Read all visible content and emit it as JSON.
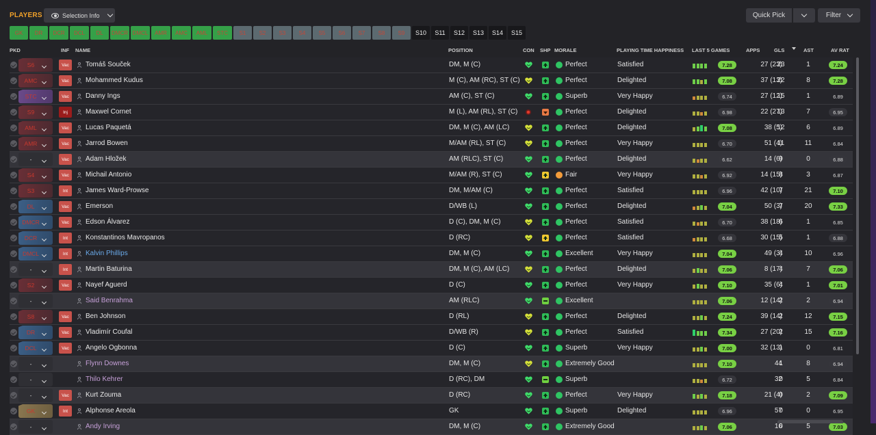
{
  "header": {
    "title": "PLAYERS",
    "view_button": "Selection Info",
    "quick_pick": "Quick Pick",
    "filter": "Filter"
  },
  "position_tabs": [
    {
      "label": "GK",
      "state": "green"
    },
    {
      "label": "DR",
      "state": "green"
    },
    {
      "label": "DCR",
      "state": "green"
    },
    {
      "label": "DCL",
      "state": "green"
    },
    {
      "label": "DL",
      "state": "green"
    },
    {
      "label": "DMCR",
      "state": "green"
    },
    {
      "label": "DMCL",
      "state": "green"
    },
    {
      "label": "AMR",
      "state": "green"
    },
    {
      "label": "AMC",
      "state": "green"
    },
    {
      "label": "AML",
      "state": "green"
    },
    {
      "label": "STC",
      "state": "green"
    },
    {
      "label": "S1",
      "state": "grey"
    },
    {
      "label": "S2",
      "state": "grey"
    },
    {
      "label": "S3",
      "state": "grey"
    },
    {
      "label": "S4",
      "state": "grey"
    },
    {
      "label": "S5",
      "state": "grey"
    },
    {
      "label": "S6",
      "state": "grey"
    },
    {
      "label": "S7",
      "state": "grey"
    },
    {
      "label": "S8",
      "state": "grey"
    },
    {
      "label": "S9",
      "state": "grey"
    },
    {
      "label": "S10",
      "state": "dark"
    },
    {
      "label": "S11",
      "state": "dark"
    },
    {
      "label": "S12",
      "state": "dark"
    },
    {
      "label": "S13",
      "state": "dark"
    },
    {
      "label": "S14",
      "state": "dark"
    },
    {
      "label": "S15",
      "state": "dark"
    }
  ],
  "columns": {
    "pkd": "PKD",
    "inf": "INF",
    "name": "NAME",
    "position": "POSITION",
    "con": "CON",
    "shp": "SHP",
    "morale": "MORALE",
    "pth": "PLAYING TIME HAPPINESS",
    "last5": "LAST 5 GAMES",
    "apps": "APPS",
    "gls": "GLS",
    "ast": "AST",
    "avrat": "AV RAT"
  },
  "colors": {
    "accent": "#f0a12a",
    "rating_good": "#78d044",
    "morale_good": "#2fc463",
    "morale_fair": "#f29b3a"
  },
  "players": [
    {
      "pkd": "S6",
      "pkd_color": "red",
      "inf": "Vac",
      "name": "Tomáš Souček",
      "name_color": "",
      "pos": "DM, M (C)",
      "con": "green",
      "shp": "green",
      "mor_ic": "green",
      "morale": "Perfect",
      "pth": "Satisfied",
      "form": "gggg",
      "l5": "7.28",
      "l5c": "g",
      "apps": "27 (23)",
      "gls": "23",
      "ast": "1",
      "avr": "7.24",
      "avrc": "g",
      "hl": false
    },
    {
      "pkd": "AMC",
      "pkd_color": "red",
      "inf": "Vac",
      "name": "Mohammed Kudus",
      "name_color": "",
      "pos": "M (C), AM (RC), ST (C)",
      "con": "yellow",
      "shp": "green",
      "mor_ic": "green",
      "morale": "Perfect",
      "pth": "Delighted",
      "form": "ggyg",
      "l5": "7.08",
      "l5c": "g",
      "apps": "37 (13)",
      "gls": "22",
      "ast": "8",
      "avr": "7.28",
      "avrc": "g",
      "hl": false
    },
    {
      "pkd": "STC",
      "pkd_color": "purple",
      "inf": "Vac",
      "name": "Danny Ings",
      "name_color": "",
      "pos": "AM (C), ST (C)",
      "con": "green",
      "shp": "green",
      "mor_ic": "green",
      "morale": "Superb",
      "pth": "Very Happy",
      "form": "oyyy",
      "l5": "6.74",
      "l5c": "d",
      "apps": "27 (12)",
      "gls": "15",
      "ast": "1",
      "avr": "6.89",
      "avrc": "plain",
      "hl": false
    },
    {
      "pkd": "S9",
      "pkd_color": "red",
      "inf": "Inj",
      "name": "Maxwel Cornet",
      "name_color": "",
      "pos": "M (L), AM (RL), ST (C)",
      "con": "red",
      "shp": "orange",
      "mor_ic": "green",
      "morale": "Perfect",
      "pth": "Delighted",
      "form": "yyoy",
      "l5": "6.98",
      "l5c": "d",
      "apps": "22 (27)",
      "gls": "13",
      "ast": "7",
      "avr": "6.95",
      "avrc": "d",
      "hl": false
    },
    {
      "pkd": "AML",
      "pkd_color": "red",
      "inf": "Vac",
      "name": "Lucas Paquetá",
      "name_color": "",
      "pos": "DM, M (C), AM (LC)",
      "con": "yellow",
      "shp": "green",
      "mor_ic": "green",
      "morale": "Perfect",
      "pth": "Delighted",
      "form": "ygGg",
      "l5": "7.08",
      "l5c": "g",
      "apps": "38 (5)",
      "gls": "12",
      "ast": "6",
      "avr": "6.89",
      "avrc": "plain",
      "hl": false
    },
    {
      "pkd": "AMR",
      "pkd_color": "red",
      "inf": "Vac",
      "name": "Jarrod Bowen",
      "name_color": "",
      "pos": "M/AM (RL), ST (C)",
      "con": "yellow",
      "shp": "green",
      "mor_ic": "green",
      "morale": "Perfect",
      "pth": "Very Happy",
      "form": "yyyy",
      "l5": "6.70",
      "l5c": "d",
      "apps": "51 (4)",
      "gls": "11",
      "ast": "11",
      "avr": "6.84",
      "avrc": "plain",
      "hl": false
    },
    {
      "pkd": "-",
      "pkd_color": "empty",
      "inf": "Vac",
      "name": "Adam Hložek",
      "name_color": "",
      "pos": "AM (RLC), ST (C)",
      "con": "green",
      "shp": "green",
      "mor_ic": "green",
      "morale": "Perfect",
      "pth": "Delighted",
      "form": "yoyy",
      "l5": "6.62",
      "l5c": "d",
      "apps": "14 (6)",
      "gls": "9",
      "ast": "0",
      "avr": "6.88",
      "avrc": "d",
      "hl": true
    },
    {
      "pkd": "S4",
      "pkd_color": "red",
      "inf": "Vac",
      "name": "Michail Antonio",
      "name_color": "",
      "pos": "M/AM (R), ST (C)",
      "con": "green",
      "shp": "yellow",
      "mor_ic": "orange",
      "morale": "Fair",
      "pth": "Very Happy",
      "form": "yyoy",
      "l5": "6.92",
      "l5c": "d",
      "apps": "14 (15)",
      "gls": "8",
      "ast": "3",
      "avr": "6.87",
      "avrc": "plain",
      "hl": false
    },
    {
      "pkd": "S3",
      "pkd_color": "red",
      "inf": "Int",
      "name": "James Ward-Prowse",
      "name_color": "",
      "pos": "DM, M/AM (C)",
      "con": "green",
      "shp": "green",
      "mor_ic": "green",
      "morale": "Perfect",
      "pth": "Satisfied",
      "form": "yyyy",
      "l5": "6.96",
      "l5c": "d",
      "apps": "42 (10)",
      "gls": "7",
      "ast": "21",
      "avr": "7.10",
      "avrc": "g",
      "hl": false
    },
    {
      "pkd": "DL",
      "pkd_color": "blue",
      "inf": "Vac",
      "name": "Emerson",
      "name_color": "",
      "pos": "D/WB (L)",
      "con": "green",
      "shp": "green",
      "mor_ic": "green",
      "morale": "Perfect",
      "pth": "Delighted",
      "form": "oygy",
      "l5": "7.04",
      "l5c": "g",
      "apps": "50 (3)",
      "gls": "7",
      "ast": "20",
      "avr": "7.33",
      "avrc": "g",
      "hl": false
    },
    {
      "pkd": "DMCR",
      "pkd_color": "blue",
      "inf": "Vac",
      "name": "Edson Álvarez",
      "name_color": "",
      "pos": "D (C), DM, M (C)",
      "con": "yellow",
      "shp": "green",
      "mor_ic": "green",
      "morale": "Perfect",
      "pth": "Satisfied",
      "form": "yoyy",
      "l5": "6.70",
      "l5c": "d",
      "apps": "38 (18)",
      "gls": "6",
      "ast": "1",
      "avr": "6.85",
      "avrc": "plain",
      "hl": false
    },
    {
      "pkd": "DCR",
      "pkd_color": "blue",
      "inf": "Int",
      "name": "Konstantinos Mavropanos",
      "name_color": "",
      "pos": "D (RC)",
      "con": "yellow",
      "shp": "yellow",
      "mor_ic": "green",
      "morale": "Perfect",
      "pth": "Satisfied",
      "form": "oyyy",
      "l5": "6.68",
      "l5c": "d",
      "apps": "30 (15)",
      "gls": "5",
      "ast": "1",
      "avr": "6.88",
      "avrc": "d",
      "hl": false
    },
    {
      "pkd": "DMCL",
      "pkd_color": "blue",
      "inf": "Int",
      "name": "Kalvin Phillips",
      "name_color": "blue",
      "pos": "DM, M (C)",
      "con": "green",
      "shp": "green",
      "mor_ic": "green",
      "morale": "Excellent",
      "pth": "Very Happy",
      "form": "yyyy",
      "l5": "7.04",
      "l5c": "g",
      "apps": "49 (3)",
      "gls": "4",
      "ast": "10",
      "avr": "6.96",
      "avrc": "plain",
      "hl": false
    },
    {
      "pkd": "-",
      "pkd_color": "empty",
      "inf": "Int",
      "name": "Martin Baturina",
      "name_color": "",
      "pos": "DM, M (C), AM (LC)",
      "con": "yellow",
      "shp": "green",
      "mor_ic": "green",
      "morale": "Perfect",
      "pth": "Delighted",
      "form": "ygyy",
      "l5": "7.06",
      "l5c": "g",
      "apps": "8 (17)",
      "gls": "4",
      "ast": "7",
      "avr": "7.06",
      "avrc": "g",
      "hl": true
    },
    {
      "pkd": "S2",
      "pkd_color": "red",
      "inf": "Vac",
      "name": "Nayef Aguerd",
      "name_color": "",
      "pos": "D (C)",
      "con": "green",
      "shp": "green",
      "mor_ic": "green",
      "morale": "Perfect",
      "pth": "Very Happy",
      "form": "ygyy",
      "l5": "7.10",
      "l5c": "g",
      "apps": "35 (6)",
      "gls": "4",
      "ast": "1",
      "avr": "7.01",
      "avrc": "g",
      "hl": false
    },
    {
      "pkd": "-",
      "pkd_color": "empty",
      "inf": "",
      "name": "Said Benrahma",
      "name_color": "pink",
      "pos": "AM (RLC)",
      "con": "green",
      "shp": "lime",
      "mor_ic": "green",
      "morale": "Excellent",
      "pth": "",
      "form": "yyyy",
      "l5": "7.06",
      "l5c": "g",
      "apps": "12 (14)",
      "gls": "2",
      "ast": "2",
      "avr": "6.94",
      "avrc": "d",
      "hl": true
    },
    {
      "pkd": "S8",
      "pkd_color": "red",
      "inf": "Vac",
      "name": "Ben Johnson",
      "name_color": "",
      "pos": "D (RL)",
      "con": "yellow",
      "shp": "green",
      "mor_ic": "green",
      "morale": "Perfect",
      "pth": "Delighted",
      "form": "yygy",
      "l5": "7.24",
      "l5c": "g",
      "apps": "39 (14)",
      "gls": "2",
      "ast": "12",
      "avr": "7.15",
      "avrc": "g",
      "hl": false
    },
    {
      "pkd": "DR",
      "pkd_color": "blue",
      "inf": "Vac",
      "name": "Vladimír Coufal",
      "name_color": "",
      "pos": "D/WB (R)",
      "con": "yellow",
      "shp": "green",
      "mor_ic": "green",
      "morale": "Perfect",
      "pth": "Satisfied",
      "form": "Gggg",
      "l5": "7.34",
      "l5c": "g",
      "apps": "27 (20)",
      "gls": "2",
      "ast": "15",
      "avr": "7.16",
      "avrc": "g",
      "hl": false
    },
    {
      "pkd": "DCL",
      "pkd_color": "blue",
      "inf": "Vac",
      "name": "Angelo Ogbonna",
      "name_color": "",
      "pos": "D (C)",
      "con": "green",
      "shp": "green",
      "mor_ic": "green",
      "morale": "Superb",
      "pth": "Very Happy",
      "form": "yygy",
      "l5": "7.00",
      "l5c": "g",
      "apps": "32 (13)",
      "gls": "1",
      "ast": "0",
      "avr": "6.81",
      "avrc": "plain",
      "hl": false
    },
    {
      "pkd": "-",
      "pkd_color": "empty",
      "inf": "",
      "name": "Flynn Downes",
      "name_color": "pink",
      "pos": "DM, M (C)",
      "con": "yellow",
      "shp": "green",
      "mor_ic": "green",
      "morale": "Extremely Good",
      "pth": "",
      "form": "yyyy",
      "l5": "7.10",
      "l5c": "g",
      "apps": "44",
      "gls": "1",
      "ast": "8",
      "avr": "6.94",
      "avrc": "d",
      "hl": true
    },
    {
      "pkd": "-",
      "pkd_color": "empty",
      "inf": "",
      "name": "Thilo Kehrer",
      "name_color": "pink",
      "pos": "D (RC), DM",
      "con": "green",
      "shp": "lime",
      "mor_ic": "green",
      "morale": "Superb",
      "pth": "",
      "form": "yyoy",
      "l5": "6.72",
      "l5c": "d",
      "apps": "32",
      "gls": "0",
      "ast": "5",
      "avr": "6.84",
      "avrc": "plain",
      "hl": false
    },
    {
      "pkd": "-",
      "pkd_color": "empty",
      "inf": "Vac",
      "name": "Kurt Zouma",
      "name_color": "",
      "pos": "D (RC)",
      "con": "green",
      "shp": "green",
      "mor_ic": "green",
      "morale": "Perfect",
      "pth": "Very Happy",
      "form": "gygy",
      "l5": "7.18",
      "l5c": "g",
      "apps": "21 (4)",
      "gls": "0",
      "ast": "2",
      "avr": "7.09",
      "avrc": "g",
      "hl": true
    },
    {
      "pkd": "GK",
      "pkd_color": "gold",
      "inf": "Int",
      "name": "Alphonse Areola",
      "name_color": "",
      "pos": "GK",
      "con": "green",
      "shp": "green",
      "mor_ic": "green",
      "morale": "Superb",
      "pth": "Delighted",
      "form": "yyyy",
      "l5": "6.96",
      "l5c": "d",
      "apps": "57",
      "gls": "0",
      "ast": "0",
      "avr": "6.95",
      "avrc": "plain",
      "hl": false
    },
    {
      "pkd": "-",
      "pkd_color": "empty",
      "inf": "",
      "name": "Andy Irving",
      "name_color": "pink",
      "pos": "DM, M (C)",
      "con": "green",
      "shp": "green",
      "mor_ic": "green",
      "morale": "Extremely Good",
      "pth": "",
      "form": "yygy",
      "l5": "7.06",
      "l5c": "g",
      "apps": "16",
      "gls": "0",
      "ast": "5",
      "avr": "7.03",
      "avrc": "g",
      "hl": true
    }
  ]
}
